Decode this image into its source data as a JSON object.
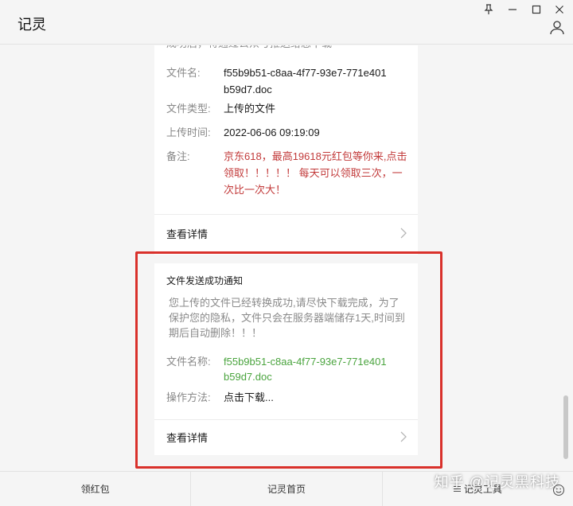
{
  "app": {
    "title": "记灵"
  },
  "card1": {
    "intro_tail": "成功后，将通过公众号推送给您下载~",
    "fields": [
      {
        "label": "文件名:",
        "value_line1": "f55b9b51-c8aa-4f77-93e7-771e401",
        "value_line2": "b59d7.doc"
      },
      {
        "label": "文件类型:",
        "value_line1": "上传的文件"
      },
      {
        "label": "上传时间:",
        "value_line1": "2022-06-06 09:19:09"
      },
      {
        "label": "备注:",
        "value_line1": "京东618，最高19618元红包等你来,点击",
        "value_line2": "领取！！！！！ 每天可以领取三次，一",
        "value_line3": "次比一次大！"
      }
    ],
    "detail_label": "查看详情"
  },
  "card2": {
    "title": "文件发送成功通知",
    "desc_line1": "您上传的文件已经转换成功,请尽快下载完成，为了",
    "desc_line2": "保护您的隐私，文件只会在服务器端储存1天,时间到",
    "desc_line3": "期后自动删除！！！",
    "filename_label": "文件名称:",
    "filename_line1": "f55b9b51-c8aa-4f77-93e7-771e401",
    "filename_line2": "b59d7.doc",
    "method_label": "操作方法:",
    "method_value": "点击下载...",
    "detail_label": "查看详情"
  },
  "bottom_tabs": [
    {
      "label": "领红包"
    },
    {
      "label": "记灵首页"
    },
    {
      "label": "记灵工具"
    }
  ],
  "watermark": "知乎 @记灵黑科技",
  "colors": {
    "highlight": "#d9312b",
    "red_text": "#c23a3a",
    "green_text": "#4aa43e",
    "bg": "#f5f5f5"
  }
}
